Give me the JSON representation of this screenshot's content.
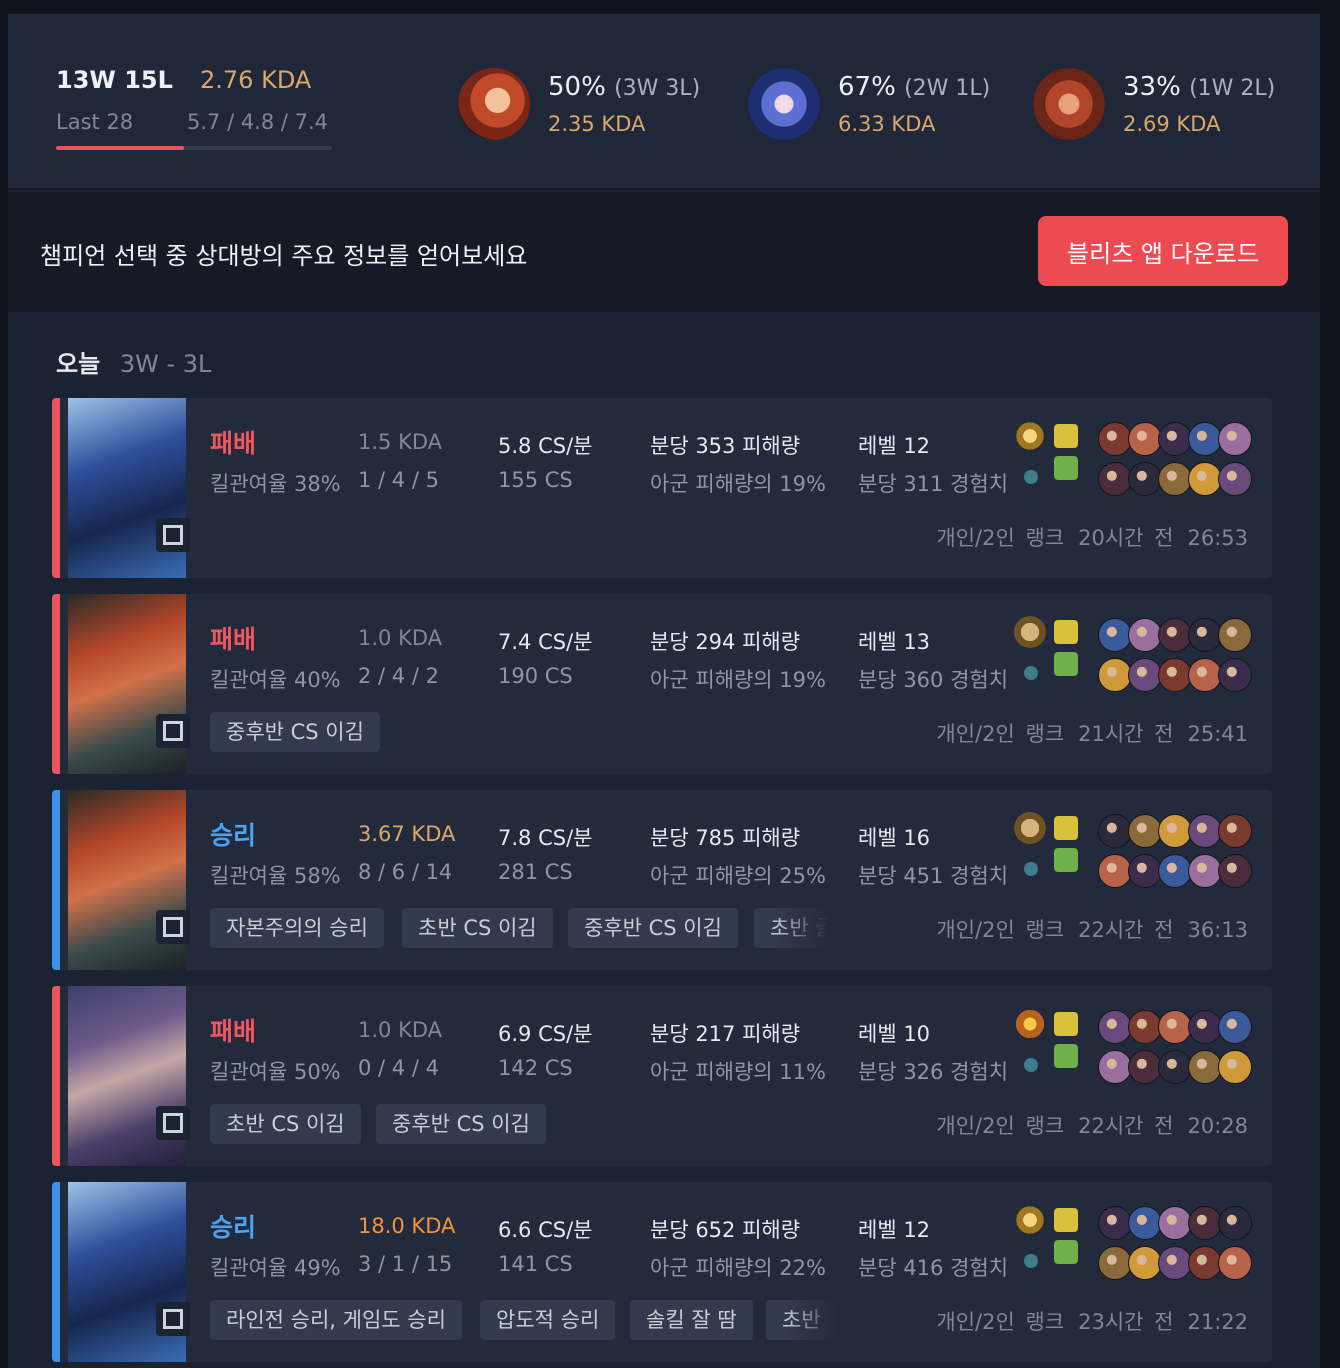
{
  "summary": {
    "record": "13W 15L",
    "kda": "2.76 KDA",
    "last_label": "Last 28",
    "kda_breakdown": "5.7 / 4.8 / 7.4",
    "winrate_fraction": 0.4643,
    "champions": [
      {
        "pct": "50%",
        "wl": "(3W 3L)",
        "kda": "2.35 KDA",
        "icon": "miss-fortune-portrait"
      },
      {
        "pct": "67%",
        "wl": "(2W 1L)",
        "kda": "6.33 KDA",
        "icon": "ashe-portrait"
      },
      {
        "pct": "33%",
        "wl": "(1W 2L)",
        "kda": "2.69 KDA",
        "icon": "gragas-portrait"
      }
    ]
  },
  "banner": {
    "text": "챔피언 선택 중 상대방의 주요 정보를 얻어보세요",
    "button": "블리츠 앱 다운로드"
  },
  "today": {
    "label": "오늘",
    "record": "3W - 3L"
  },
  "matches": [
    {
      "result": "패배",
      "kill_participation": "킬관여율 38%",
      "kda": "1.5 KDA",
      "kda_line": "1 / 4 / 5",
      "cs_per_min": "5.8 CS/분",
      "cs_total": "155 CS",
      "dmg": "분당 353 피해량",
      "dmg_share": "아군 피해량의 19%",
      "level": "레벨 12",
      "xp": "분당 311 경험치",
      "tags": [],
      "queue": "개인/2인 랭크",
      "ago": "20시간 전",
      "duration": "26:53"
    },
    {
      "result": "패배",
      "kill_participation": "킬관여율 40%",
      "kda": "1.0 KDA",
      "kda_line": "2 / 4 / 2",
      "cs_per_min": "7.4 CS/분",
      "cs_total": "190 CS",
      "dmg": "분당 294 피해량",
      "dmg_share": "아군 피해량의 19%",
      "level": "레벨 13",
      "xp": "분당 360 경험치",
      "tags": [
        "중후반 CS 이김"
      ],
      "queue": "개인/2인 랭크",
      "ago": "21시간 전",
      "duration": "25:41"
    },
    {
      "result": "승리",
      "kill_participation": "킬관여율 58%",
      "kda": "3.67 KDA",
      "kda_line": "8 / 6 / 14",
      "cs_per_min": "7.8 CS/분",
      "cs_total": "281 CS",
      "dmg": "분당 785 피해량",
      "dmg_share": "아군 피해량의 25%",
      "level": "레벨 16",
      "xp": "분당 451 경험치",
      "tags": [
        "자본주의의 승리",
        "초반 CS 이김",
        "중후반 CS 이김",
        "초반 골"
      ],
      "queue": "개인/2인 랭크",
      "ago": "22시간 전",
      "duration": "36:13"
    },
    {
      "result": "패배",
      "kill_participation": "킬관여율 50%",
      "kda": "1.0 KDA",
      "kda_line": "0 / 4 / 4",
      "cs_per_min": "6.9 CS/분",
      "cs_total": "142 CS",
      "dmg": "분당 217 피해량",
      "dmg_share": "아군 피해량의 11%",
      "level": "레벨 10",
      "xp": "분당 326 경험치",
      "tags": [
        "초반 CS 이김",
        "중후반 CS 이김"
      ],
      "queue": "개인/2인 랭크",
      "ago": "22시간 전",
      "duration": "20:28"
    },
    {
      "result": "승리",
      "kill_participation": "킬관여율 49%",
      "kda": "18.0 KDA",
      "kda_line": "3 / 1 / 15",
      "cs_per_min": "6.6 CS/분",
      "cs_total": "141 CS",
      "dmg": "분당 652 피해량",
      "dmg_share": "아군 피해량의 22%",
      "level": "레벨 12",
      "xp": "분당 416 경험치",
      "tags": [
        "라인전 승리, 게임도 승리",
        "압도적 승리",
        "솔킬 잘 땀",
        "초반"
      ],
      "queue": "개인/2인 랭크",
      "ago": "23시간 전",
      "duration": "21:22"
    }
  ]
}
